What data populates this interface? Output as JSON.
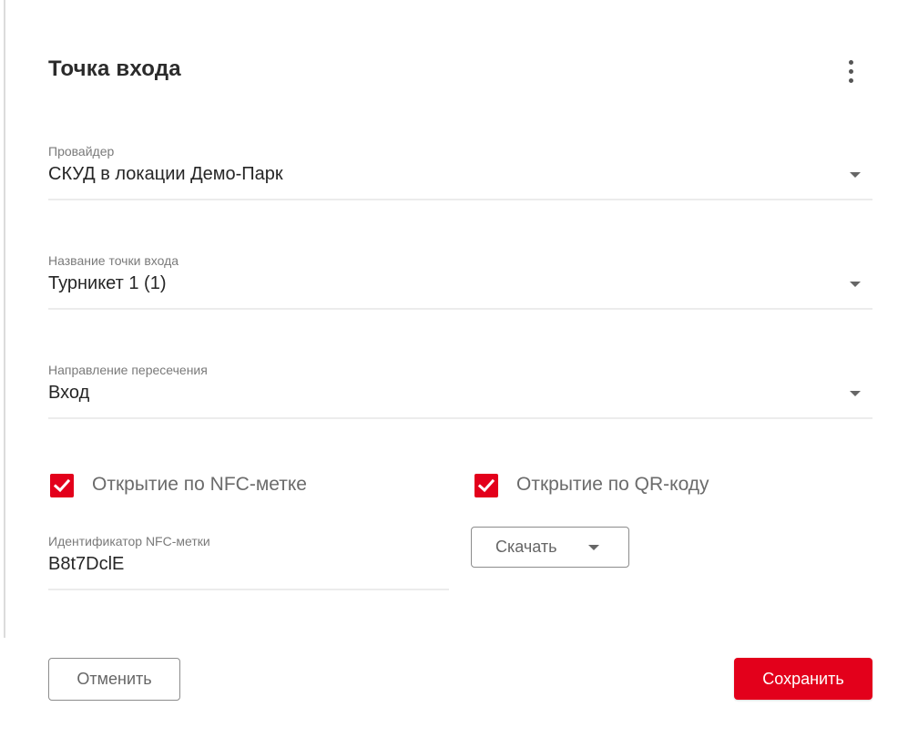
{
  "dialog": {
    "title": "Точка входа"
  },
  "fields": {
    "provider": {
      "label": "Провайдер",
      "value": "СКУД в локации Демо-Парк"
    },
    "entry_point_name": {
      "label": "Название точки входа",
      "value": "Турникет 1 (1)"
    },
    "direction": {
      "label": "Направление пересечения",
      "value": "Вход"
    }
  },
  "options": {
    "nfc": {
      "label": "Открытие по NFC-метке",
      "checked": true
    },
    "qr": {
      "label": "Открытие по QR-коду",
      "checked": true
    }
  },
  "nfc_id": {
    "label": "Идентификатор NFC-метки",
    "value": "B8t7DclE"
  },
  "buttons": {
    "download": "Скачать",
    "cancel": "Отменить",
    "save": "Сохранить"
  },
  "colors": {
    "accent": "#e3001b"
  },
  "icons": {
    "menu": "more-vertical-icon",
    "dropdown": "chevron-down-icon",
    "checkbox": "checkmark-icon"
  }
}
